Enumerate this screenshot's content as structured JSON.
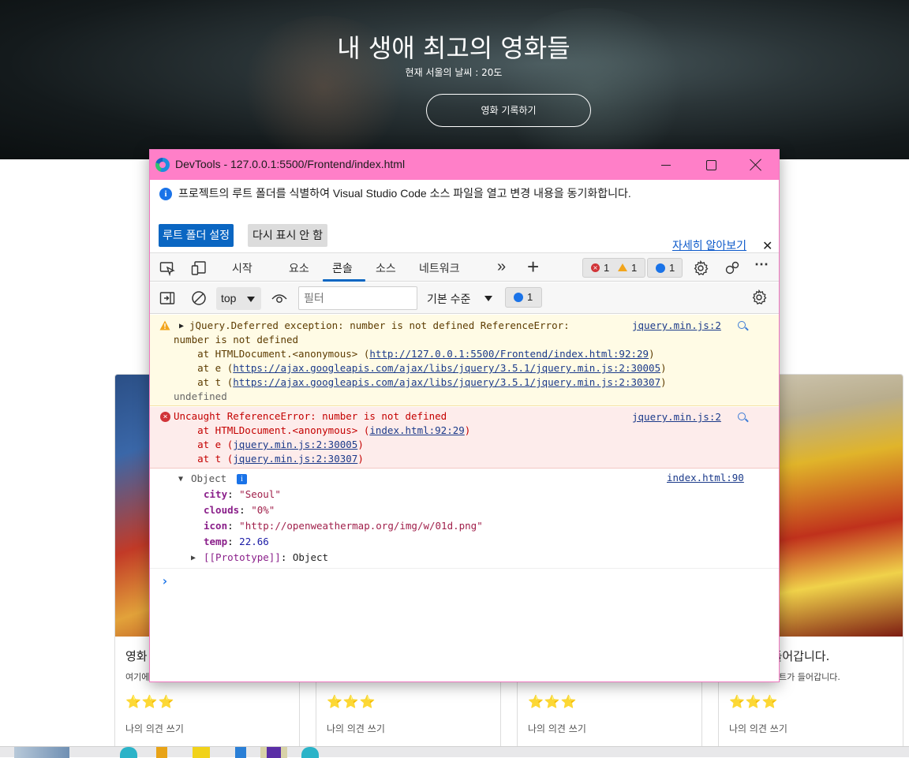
{
  "hero": {
    "title": "내 생애 최고의 영화들",
    "weather": "현재 서울의 날씨 : 20도",
    "record_button": "영화 기록하기"
  },
  "cards": [
    {
      "title": "영화",
      "desc": "여기에",
      "stars": "⭐⭐⭐",
      "comment": "나의 의견 쓰기"
    },
    {
      "title": "",
      "desc": "",
      "stars": "⭐⭐⭐",
      "comment": "나의 의견 쓰기"
    },
    {
      "title": "",
      "desc": "",
      "stars": "⭐⭐⭐",
      "comment": "나의 의견 쓰기"
    },
    {
      "title": "이 들어갑니다.",
      "desc": "트가 들어갑니다.",
      "stars": "⭐⭐⭐",
      "comment": "나의 의견 쓰기"
    }
  ],
  "devtools": {
    "window_title": "DevTools - 127.0.0.1:5500/Frontend/index.html",
    "infobar": {
      "message": "프로젝트의 루트 폴더를 식별하여 Visual Studio Code 소스 파일을 열고 변경 내용을 동기화합니다.",
      "learn_more": "자세히 알아보기",
      "set_root_button": "루트 폴더 설정",
      "dont_show_button": "다시 표시 안 함"
    },
    "tabs": [
      "시작",
      "요소",
      "콘솔",
      "소스",
      "네트워크"
    ],
    "active_tab": "콘솔",
    "counts": {
      "errors": "1",
      "warnings": "1",
      "messages": "1"
    },
    "console_toolbar": {
      "context": "top",
      "filter_placeholder": "필터",
      "level": "기본 수준",
      "message_count": "1"
    },
    "console": {
      "warning": {
        "line1": "jQuery.Deferred exception: number is not defined ReferenceError:",
        "line2": "number is not defined",
        "line3_prefix": "    at HTMLDocument.<anonymous> (",
        "line3_link": "http://127.0.0.1:5500/Frontend/index.html:92:29",
        "line4_prefix": "    at e (",
        "line4_link": "https://ajax.googleapis.com/ajax/libs/jquery/3.5.1/jquery.min.js:2:30005",
        "line5_prefix": "    at t (",
        "line5_link": "https://ajax.googleapis.com/ajax/libs/jquery/3.5.1/jquery.min.js:2:30307",
        "line6": "undefined",
        "source": "jquery.min.js:2"
      },
      "error": {
        "line1": "Uncaught ReferenceError: number is not defined",
        "line2_prefix": "    at HTMLDocument.<anonymous> (",
        "line2_link": "index.html:92:29",
        "line3_prefix": "    at e (",
        "line3_link": "jquery.min.js:2:30005",
        "line4_prefix": "    at t (",
        "line4_link": "jquery.min.js:2:30307",
        "source": "jquery.min.js:2"
      },
      "log": {
        "object_label": "Object",
        "city_key": "city",
        "city_val": "\"Seoul\"",
        "clouds_key": "clouds",
        "clouds_val": "\"0%\"",
        "icon_key": "icon",
        "icon_val": "\"http://openweathermap.org/img/w/01d.png\"",
        "temp_key": "temp",
        "temp_val": "22.66",
        "proto_key": "[[Prototype]]",
        "proto_val": "Object",
        "source": "index.html:90"
      }
    }
  }
}
